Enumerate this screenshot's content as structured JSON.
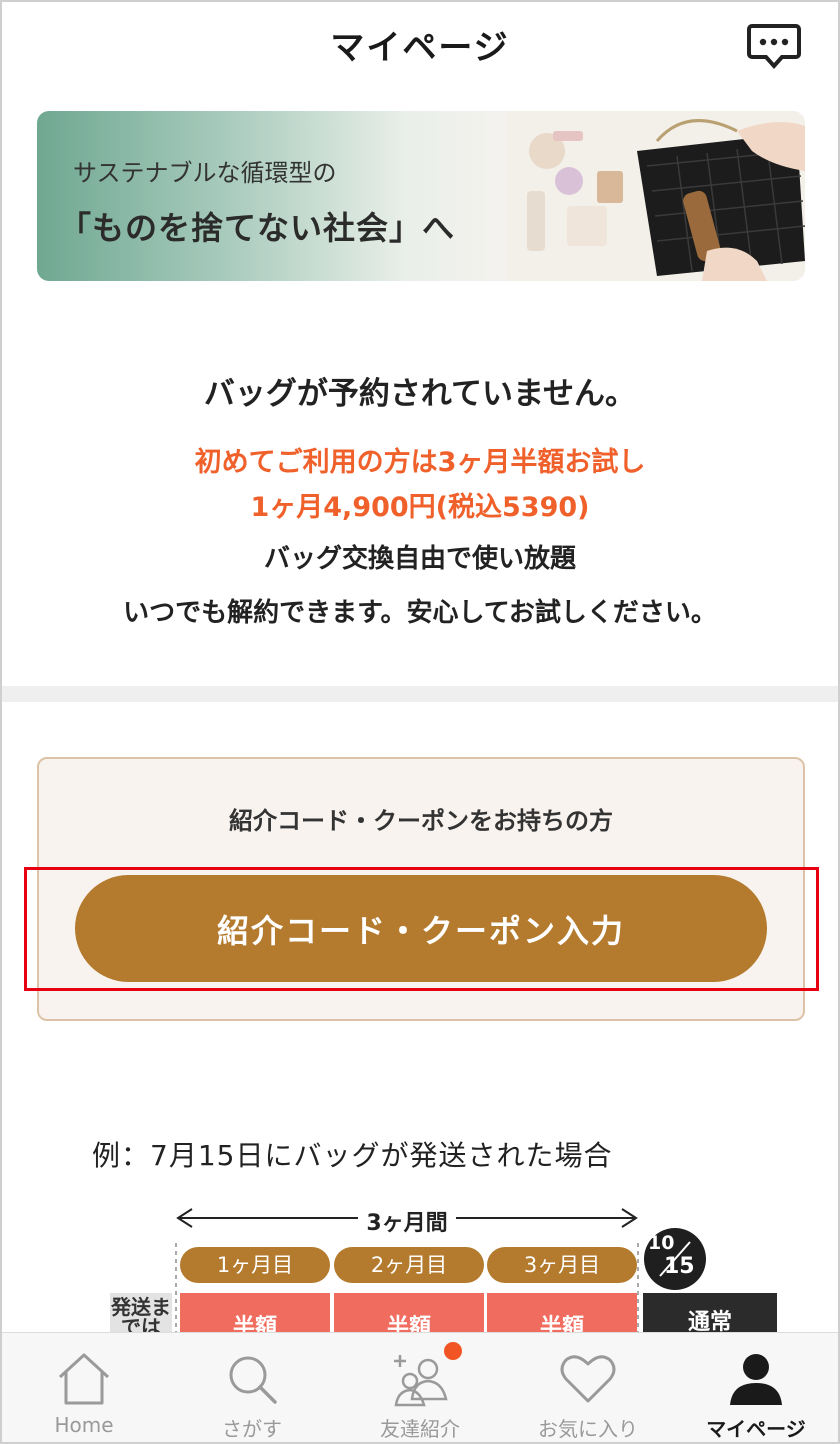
{
  "header": {
    "title": "マイページ",
    "chat_icon": "chat-bubble-icon"
  },
  "banner": {
    "line1": "サステナブルな循環型の",
    "line2": "「ものを捨てない社会」へ"
  },
  "status": {
    "main": "バッグが予約されていません。",
    "trial_line1": "初めてご利用の方は3ヶ月半額お試し",
    "trial_line2": "1ヶ月4,900円(税込5390)",
    "free_exchange": "バッグ交換自由で使い放題",
    "cancel_anytime": "いつでも解約できます。安心してお試しください。"
  },
  "coupon": {
    "caption": "紹介コード・クーポンをお持ちの方",
    "button_label": "紹介コード・クーポン入力"
  },
  "example": {
    "title": "例：7月15日にバッグが発送された場合",
    "period_label": "3ヶ月間",
    "months": [
      "1ヶ月目",
      "2ヶ月目",
      "3ヶ月目"
    ],
    "date_top": "10",
    "date_bottom": "15",
    "ship_label": "発送までは",
    "half_label": "半額",
    "normal_label": "通常"
  },
  "tabs": [
    {
      "label": "Home",
      "icon": "home-icon"
    },
    {
      "label": "さがす",
      "icon": "search-icon"
    },
    {
      "label": "友達紹介",
      "icon": "add-friends-icon"
    },
    {
      "label": "お気に入り",
      "icon": "heart-icon"
    },
    {
      "label": "マイページ",
      "icon": "user-icon",
      "active": true
    }
  ],
  "colors": {
    "accent": "#b47a2d",
    "orange_text": "#f0602b",
    "half_price": "#f06c5f",
    "badge": "#f25524",
    "highlight": "#e60012"
  }
}
